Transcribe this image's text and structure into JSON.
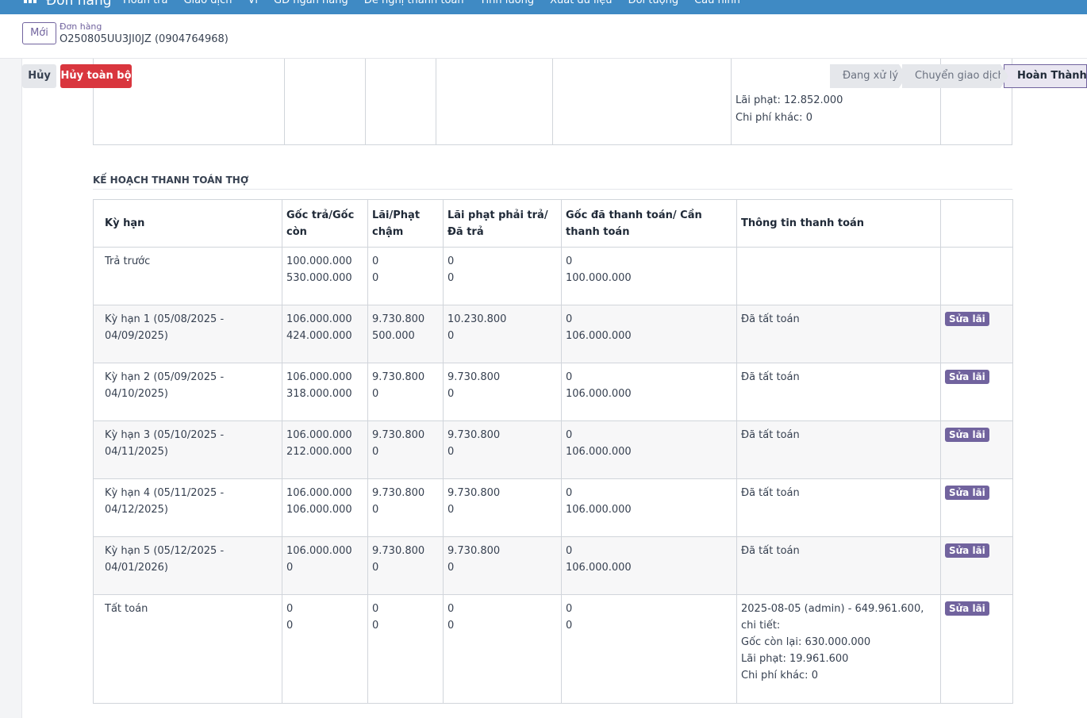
{
  "topnav": {
    "brand": "Đơn hàng",
    "menu": [
      "Hoàn trả",
      "Giao dịch",
      "Ví",
      "GD ngân hàng",
      "Đề nghị thanh toán",
      "Tính lương",
      "Xuất dữ liệu",
      "Đối tượng",
      "Cấu hình"
    ]
  },
  "breadcrumb": {
    "new_label": "Mới",
    "parent": "Đơn hàng",
    "current": "O250805UU3JI0JZ (0904764968)"
  },
  "actions": {
    "cancel_label": "Hủy",
    "cancel_all_label": "Hủy toàn bộ"
  },
  "statusbar": {
    "stages": [
      "Đang xử lý",
      "Chuyển giao dịch",
      "Hoàn Thành"
    ],
    "active": "Hoàn Thành"
  },
  "prev_table_fragment": {
    "lines": [
      "Lãi phạt: 12.852.000",
      "Chi phí khác: 0"
    ]
  },
  "section": {
    "title": "KẾ HOẠCH THANH TOÁN THỢ"
  },
  "plan_table": {
    "headers": [
      "Kỳ hạn",
      "Gốc trả/Gốc còn",
      "Lãi/Phạt chậm",
      "Lãi phạt phải trả/Đã trả",
      "Gốc đã thanh toán/ Cần thanh toán",
      "Thông tin thanh toán",
      ""
    ],
    "edit_label": "Sửa lãi",
    "rows": [
      {
        "term": "Trả trước",
        "principal": [
          "100.000.000",
          "530.000.000"
        ],
        "interest": [
          "0",
          "0"
        ],
        "penalty": [
          "0",
          "0"
        ],
        "paid": [
          "0",
          "100.000.000"
        ],
        "info": [],
        "editable": false
      },
      {
        "term": "Kỳ hạn 1 (05/08/2025 - 04/09/2025)",
        "principal": [
          "106.000.000",
          "424.000.000"
        ],
        "interest": [
          "9.730.800",
          "500.000"
        ],
        "penalty": [
          "10.230.800",
          "0"
        ],
        "paid": [
          "0",
          "106.000.000"
        ],
        "info": [
          "Đã tất toán"
        ],
        "editable": true
      },
      {
        "term": "Kỳ hạn 2 (05/09/2025 - 04/10/2025)",
        "principal": [
          "106.000.000",
          "318.000.000"
        ],
        "interest": [
          "9.730.800",
          "0"
        ],
        "penalty": [
          "9.730.800",
          "0"
        ],
        "paid": [
          "0",
          "106.000.000"
        ],
        "info": [
          "Đã tất toán"
        ],
        "editable": true
      },
      {
        "term": "Kỳ hạn 3 (05/10/2025 - 04/11/2025)",
        "principal": [
          "106.000.000",
          "212.000.000"
        ],
        "interest": [
          "9.730.800",
          "0"
        ],
        "penalty": [
          "9.730.800",
          "0"
        ],
        "paid": [
          "0",
          "106.000.000"
        ],
        "info": [
          "Đã tất toán"
        ],
        "editable": true
      },
      {
        "term": "Kỳ hạn 4 (05/11/2025 - 04/12/2025)",
        "principal": [
          "106.000.000",
          "106.000.000"
        ],
        "interest": [
          "9.730.800",
          "0"
        ],
        "penalty": [
          "9.730.800",
          "0"
        ],
        "paid": [
          "0",
          "106.000.000"
        ],
        "info": [
          "Đã tất toán"
        ],
        "editable": true
      },
      {
        "term": "Kỳ hạn 5 (05/12/2025 - 04/01/2026)",
        "principal": [
          "106.000.000",
          "0"
        ],
        "interest": [
          "9.730.800",
          "0"
        ],
        "penalty": [
          "9.730.800",
          "0"
        ],
        "paid": [
          "0",
          "106.000.000"
        ],
        "info": [
          "Đã tất toán"
        ],
        "editable": true
      },
      {
        "term": "Tất toán",
        "principal": [
          "0",
          "0"
        ],
        "interest": [
          "0",
          "0"
        ],
        "penalty": [
          "0",
          "0"
        ],
        "paid": [
          "0",
          "0"
        ],
        "info": [
          "2025-08-05 (admin) - 649.961.600, chi tiết:",
          "Gốc còn lại: 630.000.000",
          "Lãi phạt: 19.961.600",
          "Chi phí khác: 0"
        ],
        "editable": true
      }
    ]
  }
}
